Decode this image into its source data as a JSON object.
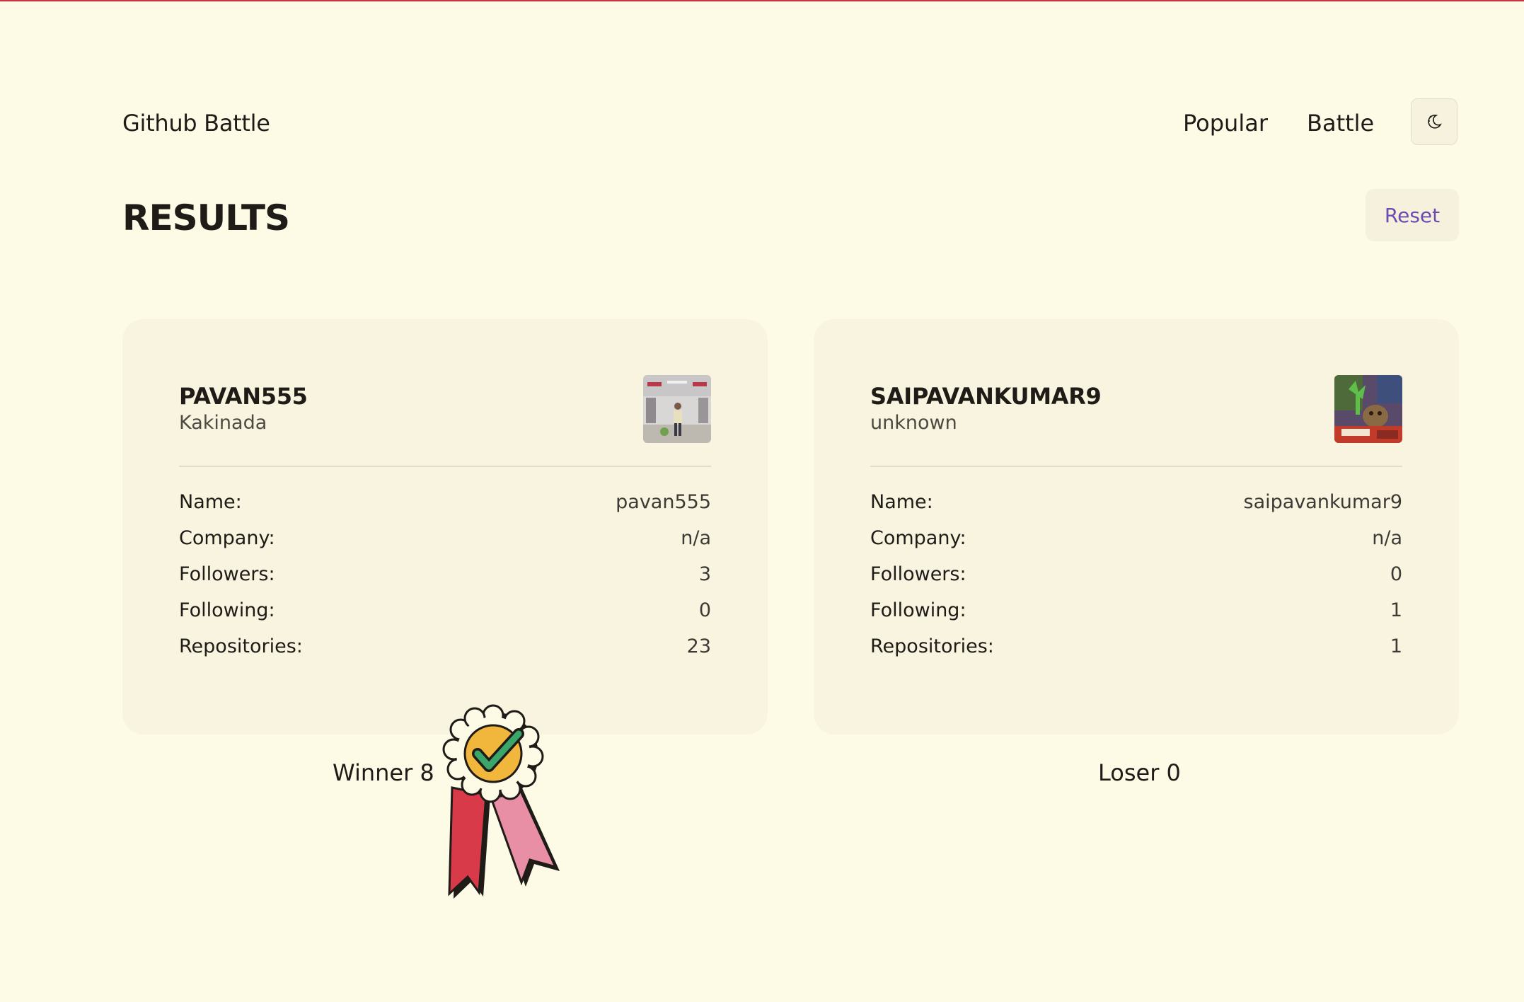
{
  "header": {
    "brand": "Github Battle",
    "nav": {
      "popular": "Popular",
      "battle": "Battle"
    },
    "theme_toggle_icon": "moon-icon"
  },
  "page": {
    "title": "RESULTS",
    "reset_label": "Reset"
  },
  "colors": {
    "background": "#fdfbe6",
    "card": "#f8f4e0",
    "accent": "#6c4cb0",
    "top_line": "#c8343f"
  },
  "players": [
    {
      "username": "PAVAN555",
      "location": "Kakinada",
      "avatar_icon": "user-photo-avatar",
      "stats": [
        {
          "label": "Name:",
          "value": "pavan555"
        },
        {
          "label": "Company:",
          "value": "n/a"
        },
        {
          "label": "Followers:",
          "value": "3"
        },
        {
          "label": "Following:",
          "value": "0"
        },
        {
          "label": "Repositories:",
          "value": "23"
        }
      ],
      "result": "Winner 8"
    },
    {
      "username": "SAIPAVANKUMAR9",
      "location": "unknown",
      "avatar_icon": "groot-avatar",
      "stats": [
        {
          "label": "Name:",
          "value": "saipavankumar9"
        },
        {
          "label": "Company:",
          "value": "n/a"
        },
        {
          "label": "Followers:",
          "value": "0"
        },
        {
          "label": "Following:",
          "value": "1"
        },
        {
          "label": "Repositories:",
          "value": "1"
        }
      ],
      "result": "Loser 0"
    }
  ],
  "winner_badge_icon": "award-ribbon-icon"
}
